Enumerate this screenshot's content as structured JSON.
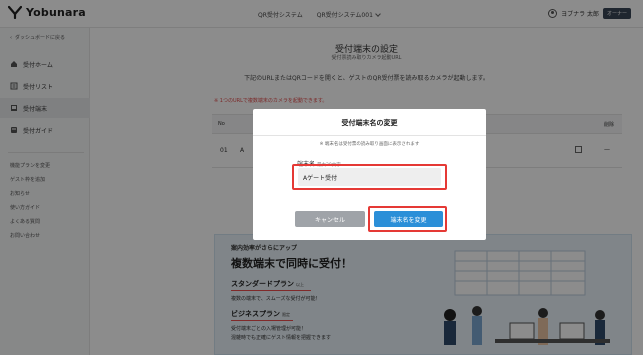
{
  "header": {
    "logo_text": "Yobunara",
    "nav": [
      "QR受付システム",
      "QR受付システム001"
    ],
    "user_name": "ヨブナラ 太郎",
    "user_role": "オーナー"
  },
  "sidebar": {
    "back_label": "ダッシュボードに戻る",
    "items": [
      {
        "label": "受付ホーム",
        "icon": "home-icon"
      },
      {
        "label": "受付リスト",
        "icon": "list-icon"
      },
      {
        "label": "受付端末",
        "icon": "terminal-icon"
      },
      {
        "label": "受付ガイド",
        "icon": "guide-icon"
      }
    ],
    "links": [
      "機能プランを変更",
      "ゲスト枠を追加",
      "お知らせ",
      "使い方ガイド",
      "よくある質問",
      "お問い合わせ"
    ]
  },
  "main": {
    "title": "受付端末の設定",
    "subtitle": "受付票読み取りカメラ起動URL",
    "description": "下記のURLまたはQRコードを開くと、ゲストのQR受付票を読み取るカメラが起動します。",
    "warning": "※ 1つのURLで複数端末のカメラを起動できます。",
    "table": {
      "head_no": "No",
      "head_delete": "削除",
      "row_no": "01",
      "row_name": "A",
      "row_delete": "—"
    }
  },
  "promo": {
    "small_title": "案内効率がさらにアップ",
    "big_title": "複数端末で同時に受付！",
    "plans": [
      {
        "name": "スタンダードプラン",
        "tag": "以上",
        "desc": "複数の端末で、スムーズな受付が可能！"
      },
      {
        "name": "ビジネスプラン",
        "tag": "限定",
        "desc": "受付端末ごとの入場管理が可能！"
      }
    ],
    "extra_desc": "混雑時でも正確にゲスト情報を把握できます"
  },
  "modal": {
    "title": "受付端末名の変更",
    "note": "※ 端末名は受付票の読み取り画面に表示されます",
    "field_label": "端末名",
    "field_limit": "最大20文字",
    "field_value": "Aゲート受付",
    "cancel_label": "キャンセル",
    "submit_label": "端末名を変更"
  },
  "colors": {
    "primary": "#2b8fd8",
    "highlight": "#e53935",
    "cancel": "#9fa3a8"
  }
}
